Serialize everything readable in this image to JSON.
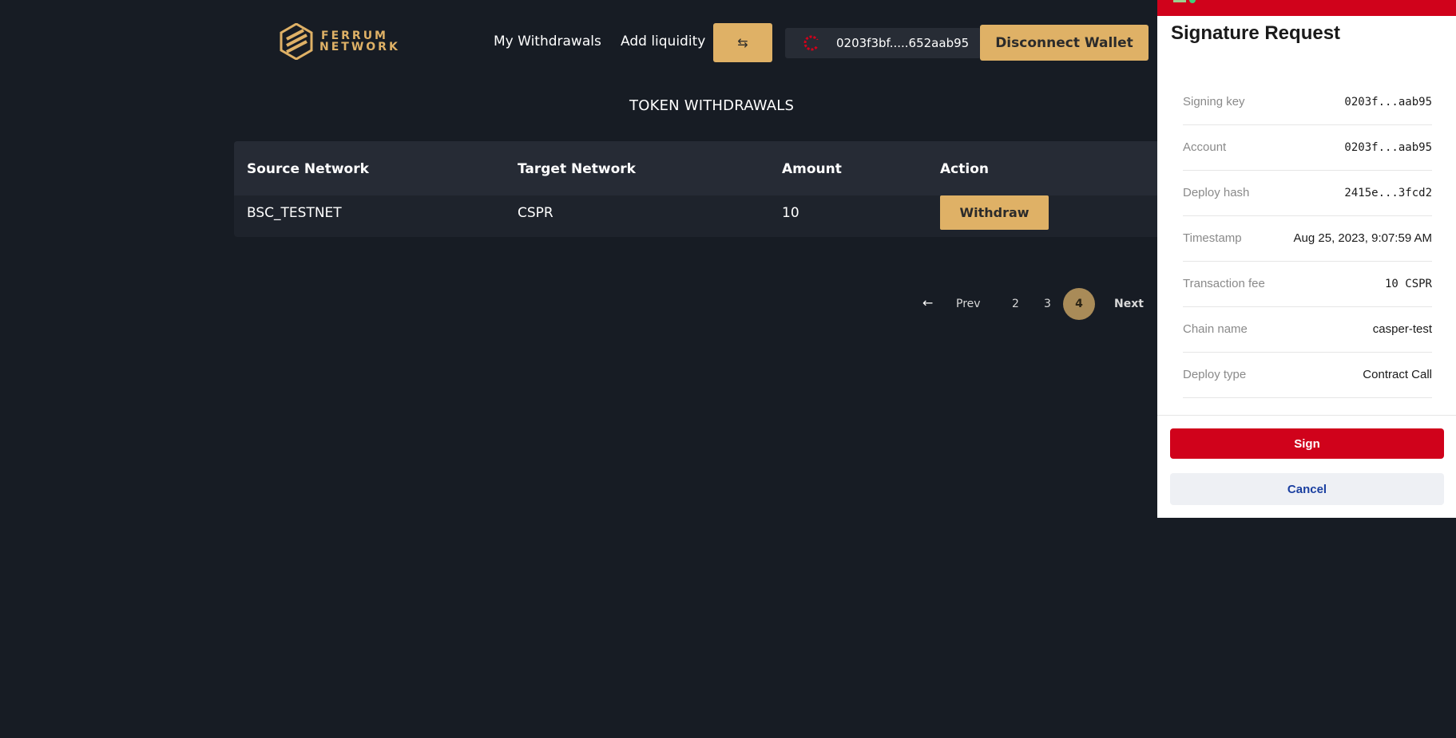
{
  "header": {
    "logo": {
      "line1": "FERRUM",
      "line2": "NETWORK"
    },
    "nav": {
      "my_withdrawals": "My Withdrawals",
      "add_liquidity": "Add liquidity"
    },
    "swap_glyph": "⇆",
    "wallet_address": "0203f3bf.....652aab95",
    "disconnect_label": "Disconnect Wallet"
  },
  "main": {
    "title": "TOKEN WITHDRAWALS",
    "table": {
      "columns": [
        "Source Network",
        "Target Network",
        "Amount",
        "Action"
      ],
      "rows": [
        {
          "source": "BSC_TESTNET",
          "target": "CSPR",
          "amount": "10",
          "action": "Withdraw"
        }
      ]
    },
    "pagination": {
      "prev_arrow": "←",
      "prev_label": "Prev",
      "pages": [
        "2",
        "3"
      ],
      "current_page": "4",
      "next_label": "Next"
    }
  },
  "popup": {
    "title": "Signature Request",
    "rows": [
      {
        "label": "Signing key",
        "value": "0203f...aab95"
      },
      {
        "label": "Account",
        "value": "0203f...aab95"
      },
      {
        "label": "Deploy hash",
        "value": "2415e...3fcd2"
      },
      {
        "label": "Timestamp",
        "value": "Aug 25, 2023, 9:07:59 AM"
      },
      {
        "label": "Transaction fee",
        "value": "10 CSPR"
      },
      {
        "label": "Chain name",
        "value": "casper-test"
      },
      {
        "label": "Deploy type",
        "value": "Contract Call"
      }
    ],
    "sign_label": "Sign",
    "cancel_label": "Cancel"
  },
  "colors": {
    "background": "#171c24",
    "accent_gold": "#dfb166",
    "casper_red": "#d0021b",
    "cancel_text": "#1a3fa0"
  },
  "icons": {
    "logo": "ferrum-hexagon-logo",
    "swap": "swap-arrows-icon",
    "wallet": "casper-wallet-icon",
    "prev": "arrow-left-icon"
  }
}
